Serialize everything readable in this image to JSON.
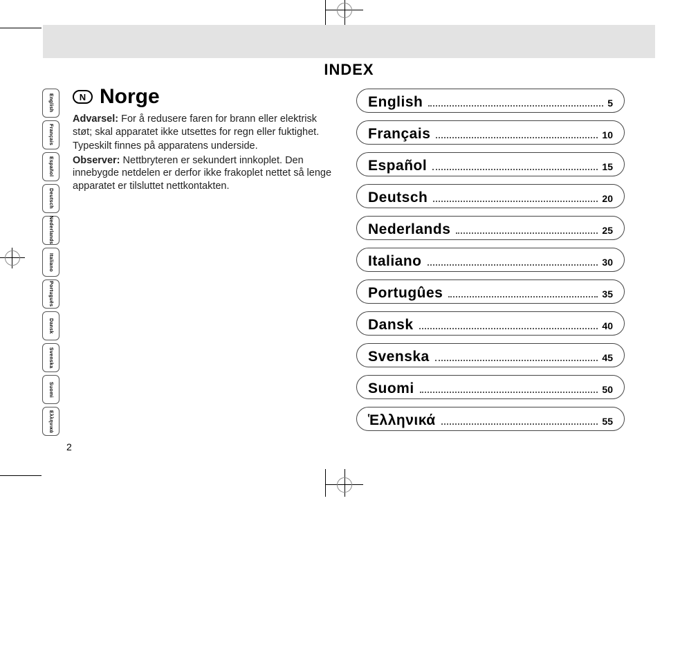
{
  "page_title": "INDEX",
  "page_number": "2",
  "norge": {
    "bullet": "N",
    "title": "Norge",
    "advarsel_label": "Advarsel:",
    "advarsel_text": " For å redusere faren for brann eller elektrisk støt; skal apparatet ikke utsettes for regn eller fuktighet.",
    "typeskilt": "Typeskilt finnes på apparatens underside.",
    "observer_label": "Observer:",
    "observer_text": " Nettbryteren er sekundert innkoplet. Den innebygde netdelen er derfor ikke frakoplet nettet så lenge apparatet er tilsluttet nettkontakten."
  },
  "tabs": [
    "English",
    "Français",
    "Español",
    "Deutsch",
    "Nederlands",
    "Italiano",
    "Português",
    "Dansk",
    "Svenska",
    "Suomi",
    "Ελληνικά"
  ],
  "index": [
    {
      "lang": "English",
      "page": "5"
    },
    {
      "lang": "Français",
      "page": "10"
    },
    {
      "lang": "Español",
      "page": "15"
    },
    {
      "lang": "Deutsch",
      "page": "20"
    },
    {
      "lang": "Nederlands",
      "page": "25"
    },
    {
      "lang": "Italiano",
      "page": "30"
    },
    {
      "lang": "Portugûes",
      "page": "35"
    },
    {
      "lang": "Dansk",
      "page": "40"
    },
    {
      "lang": "Svenska",
      "page": "45"
    },
    {
      "lang": "Suomi",
      "page": "50"
    },
    {
      "lang": "Ἑλληνικά",
      "page": "55"
    }
  ]
}
